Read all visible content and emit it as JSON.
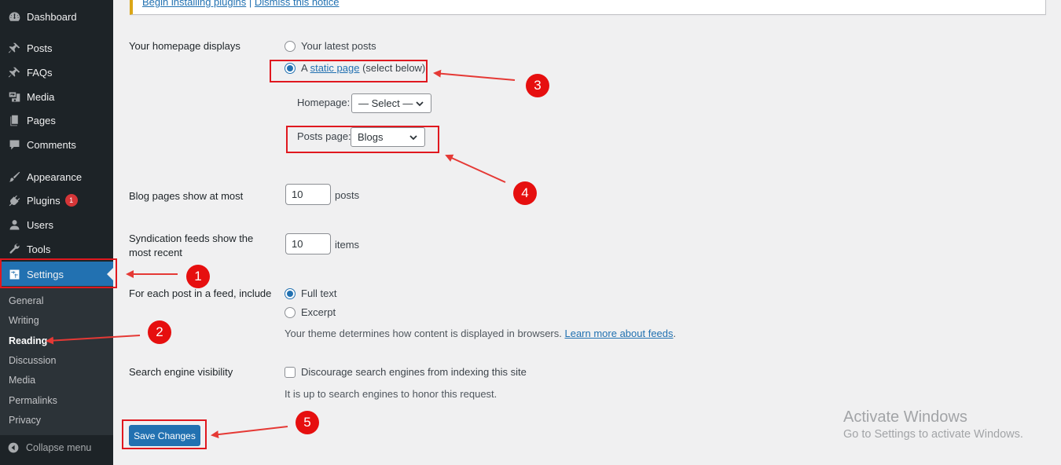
{
  "sidebar": {
    "items": [
      {
        "label": "Dashboard",
        "icon": "dashboard-icon"
      },
      {
        "label": "Posts",
        "icon": "pin-icon"
      },
      {
        "label": "FAQs",
        "icon": "pin-icon"
      },
      {
        "label": "Media",
        "icon": "media-icon"
      },
      {
        "label": "Pages",
        "icon": "pages-icon"
      },
      {
        "label": "Comments",
        "icon": "comments-icon"
      },
      {
        "label": "Appearance",
        "icon": "brush-icon"
      },
      {
        "label": "Plugins",
        "icon": "plugin-icon",
        "badge": "1"
      },
      {
        "label": "Users",
        "icon": "user-icon"
      },
      {
        "label": "Tools",
        "icon": "wrench-icon"
      },
      {
        "label": "Settings",
        "icon": "settings-icon",
        "active": true
      }
    ],
    "submenu": [
      "General",
      "Writing",
      "Reading",
      "Discussion",
      "Media",
      "Permalinks",
      "Privacy"
    ],
    "current_submenu": "Reading",
    "collapse_label": "Collapse menu"
  },
  "notice": {
    "link1": "Begin installing plugins",
    "separator": " | ",
    "link2": "Dismiss this notice"
  },
  "form": {
    "homepage_displays": {
      "label": "Your homepage displays",
      "option_latest": "Your latest posts",
      "option_static_prefix": "A ",
      "option_static_link": "static page",
      "option_static_suffix": " (select below)",
      "selected": "static page"
    },
    "homepage_select": {
      "label": "Homepage:",
      "value": "— Select —"
    },
    "posts_page_select": {
      "label": "Posts page:",
      "value": "Blogs"
    },
    "blog_pages": {
      "label": "Blog pages show at most",
      "value": "10",
      "suffix": "posts"
    },
    "syndication": {
      "label_line1": "Syndication feeds show the",
      "label_line2": "most recent",
      "value": "10",
      "suffix": "items"
    },
    "feed_include": {
      "label": "For each post in a feed, include",
      "option_full": "Full text",
      "option_excerpt": "Excerpt",
      "selected": "Full text",
      "desc_prefix": "Your theme determines how content is displayed in browsers. ",
      "desc_link": "Learn more about feeds",
      "desc_suffix": "."
    },
    "search_visibility": {
      "label": "Search engine visibility",
      "checkbox_label": "Discourage search engines from indexing this site",
      "checked": false,
      "desc": "It is up to search engines to honor this request."
    },
    "save_label": "Save Changes"
  },
  "annotations": [
    "1",
    "2",
    "3",
    "4",
    "5"
  ],
  "watermark": {
    "line1": "Activate Windows",
    "line2": "Go to Settings to activate Windows."
  },
  "colors": {
    "sidebar_bg": "#1d2327",
    "accent": "#2271b1",
    "annotation_red": "#e60f0f"
  }
}
